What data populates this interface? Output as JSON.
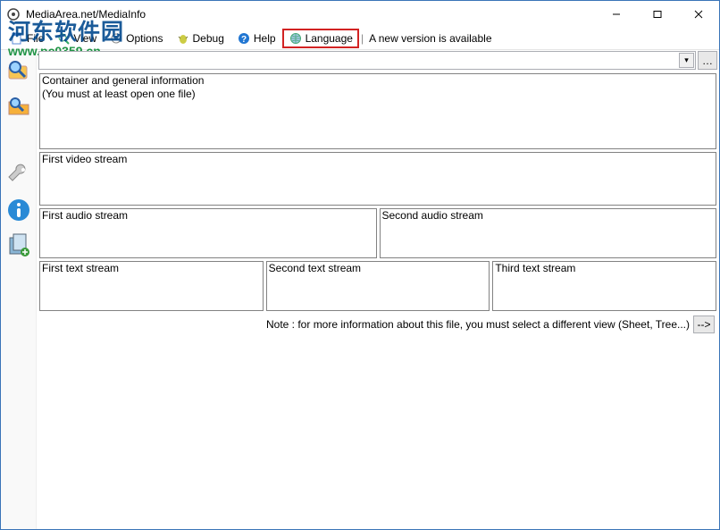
{
  "window": {
    "title": "MediaArea.net/MediaInfo"
  },
  "menu": {
    "file": "File",
    "view": "View",
    "options": "Options",
    "debug": "Debug",
    "help": "Help",
    "language": "Language",
    "sep": "|",
    "notify": "A new version is available"
  },
  "path": {
    "value": ""
  },
  "panels": {
    "general_line1": "Container and general information",
    "general_line2": "(You must at least open one file)",
    "video1": "First video stream",
    "audio1": "First audio stream",
    "audio2": "Second audio stream",
    "text1": "First text stream",
    "text2": "Second text stream",
    "text3": "Third text stream"
  },
  "note": "Note : for more information about this file, you must select a different view (Sheet, Tree...)",
  "note_btn": "-->",
  "watermark": {
    "cn": "河东软件园",
    "url": "www.pc0359.cn"
  },
  "icons": {
    "app": "mediainfo-icon",
    "file": "file-icon",
    "view": "view-icon",
    "options": "options-icon",
    "debug": "debug-icon",
    "help": "help-icon",
    "language": "globe-icon",
    "side1": "search-folder-icon",
    "side2": "open-folder-icon",
    "side3": "wrench-icon",
    "side4": "info-icon",
    "side5": "export-icon"
  },
  "colors": {
    "highlight": "#d22323",
    "border": "#3a74b8"
  }
}
